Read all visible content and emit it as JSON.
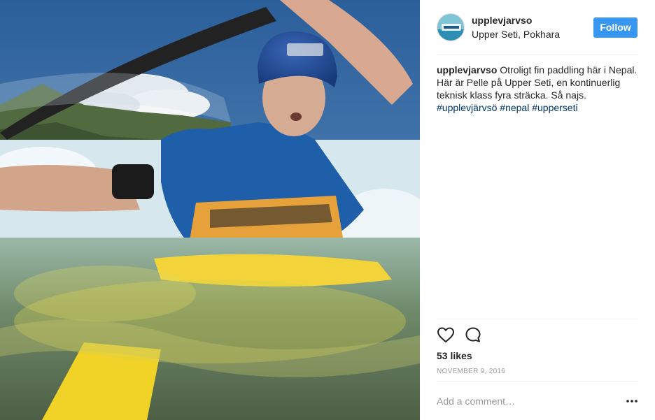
{
  "post": {
    "username": "upplevjarvso",
    "location": "Upper Seti, Pokhara",
    "follow_label": "Follow",
    "caption": {
      "username": "upplevjarvso",
      "text": " Otroligt fin paddling här i Nepal. Här är Pelle på Upper Seti, en kontinuerlig teknisk klass fyra sträcka. Så najs. ",
      "hashtags": [
        "#upplevjärvsö",
        "#nepal",
        "#upperseti"
      ]
    },
    "likes": "53 likes",
    "date": "NOVEMBER 9, 2016",
    "comment_placeholder": "Add a comment…"
  },
  "icons": {
    "like": "heart-outline-icon",
    "comment": "speech-bubble-icon",
    "more": "more-options-icon"
  },
  "colors": {
    "accent": "#3897f0",
    "hashtag": "#003569",
    "muted": "#999999"
  }
}
